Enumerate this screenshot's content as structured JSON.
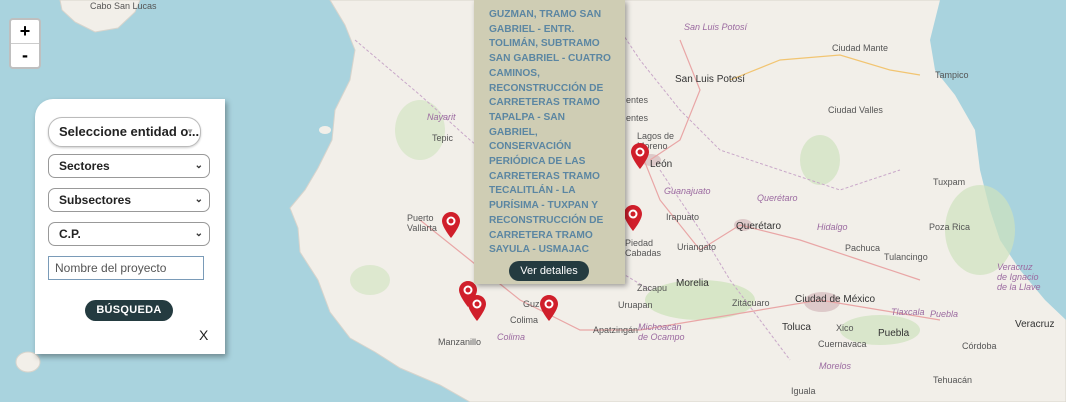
{
  "map": {
    "places": [
      {
        "name": "Cabo San Lucas",
        "cls": "place"
      },
      {
        "name": "San Luis Potosí",
        "cls": "place state"
      },
      {
        "name": "Ciudad Mante",
        "cls": "place"
      },
      {
        "name": "San Luis Potosí",
        "cls": "place city"
      },
      {
        "name": "Tampico",
        "cls": "place"
      },
      {
        "name": "Ciudad Valles",
        "cls": "place"
      },
      {
        "name": "Nayarit",
        "cls": "place state"
      },
      {
        "name": "Tepic",
        "cls": "place"
      },
      {
        "name": "Lagos de Moreno",
        "cls": "place"
      },
      {
        "name": "León",
        "cls": "place city"
      },
      {
        "name": "Guanajuato",
        "cls": "place state"
      },
      {
        "name": "Querétaro",
        "cls": "place state"
      },
      {
        "name": "Tuxpam",
        "cls": "place"
      },
      {
        "name": "Puerto Vallarta",
        "cls": "place"
      },
      {
        "name": "Irapuato",
        "cls": "place"
      },
      {
        "name": "Querétaro",
        "cls": "place city"
      },
      {
        "name": "Hidalgo",
        "cls": "place state"
      },
      {
        "name": "Poza Rica",
        "cls": "place"
      },
      {
        "name": "Piedad Cabadas",
        "cls": "place"
      },
      {
        "name": "Uriangato",
        "cls": "place"
      },
      {
        "name": "Pachuca",
        "cls": "place"
      },
      {
        "name": "Tulancingo",
        "cls": "place"
      },
      {
        "name": "Veracruz de Ignacio de la Llave",
        "cls": "place state"
      },
      {
        "name": "Zacapu",
        "cls": "place"
      },
      {
        "name": "Morelia",
        "cls": "place city"
      },
      {
        "name": "Zitácuaro",
        "cls": "place"
      },
      {
        "name": "Ciudad de México",
        "cls": "place city"
      },
      {
        "name": "Tlaxcala",
        "cls": "place state"
      },
      {
        "name": "Puebla",
        "cls": "place state"
      },
      {
        "name": "Uruapan",
        "cls": "place"
      },
      {
        "name": "Guz",
        "cls": "place"
      },
      {
        "name": "Colima",
        "cls": "place"
      },
      {
        "name": "Colima",
        "cls": "place state"
      },
      {
        "name": "Apatzingán",
        "cls": "place"
      },
      {
        "name": "Michoacán de Ocampo",
        "cls": "place state"
      },
      {
        "name": "Toluca",
        "cls": "place city"
      },
      {
        "name": "Xico",
        "cls": "place"
      },
      {
        "name": "Puebla",
        "cls": "place city"
      },
      {
        "name": "Veracruz",
        "cls": "place city"
      },
      {
        "name": "Cuernavaca",
        "cls": "place"
      },
      {
        "name": "Morelos",
        "cls": "place state"
      },
      {
        "name": "Córdoba",
        "cls": "place"
      },
      {
        "name": "Manzanillo",
        "cls": "place"
      },
      {
        "name": "Tehuacán",
        "cls": "place"
      },
      {
        "name": "Iguala",
        "cls": "place"
      },
      {
        "name": "entes",
        "cls": "place"
      },
      {
        "name": "entes",
        "cls": "place"
      }
    ]
  },
  "zoom": {
    "in": "+",
    "out": "-"
  },
  "filters": {
    "entity_select": "Seleccione entidad o...",
    "sectors_select": "Sectores",
    "subsectors_select": "Subsectores",
    "cp_select": "C.P.",
    "project_name_placeholder": "Nombre del proyecto",
    "search_button": "BÚSQUEDA",
    "close": "X"
  },
  "popup": {
    "text": "GUZMAN, TRAMO SAN GABRIEL - ENTR. TOLIMÁN, SUBTRAMO SAN GABRIEL - CUATRO CAMINOS, RECONSTRUCCIÓN DE CARRETERAS TRAMO TAPALPA - SAN GABRIEL, CONSERVACIÓN PERIÓDICA DE LAS CARRETERAS TRAMO TECALITLÁN - LA PURÍSIMA - TUXPAN Y RECONSTRUCCIÓN DE CARRETERA TRAMO SAYULA - USMAJAC",
    "details_button": "Ver detalles"
  },
  "colors": {
    "marker": "#d01f2b",
    "button": "#243b40",
    "popup_bg": "#cfcdb4",
    "popup_text": "#5b86a2",
    "sea": "#a9d3de",
    "land": "#f2efe9"
  }
}
